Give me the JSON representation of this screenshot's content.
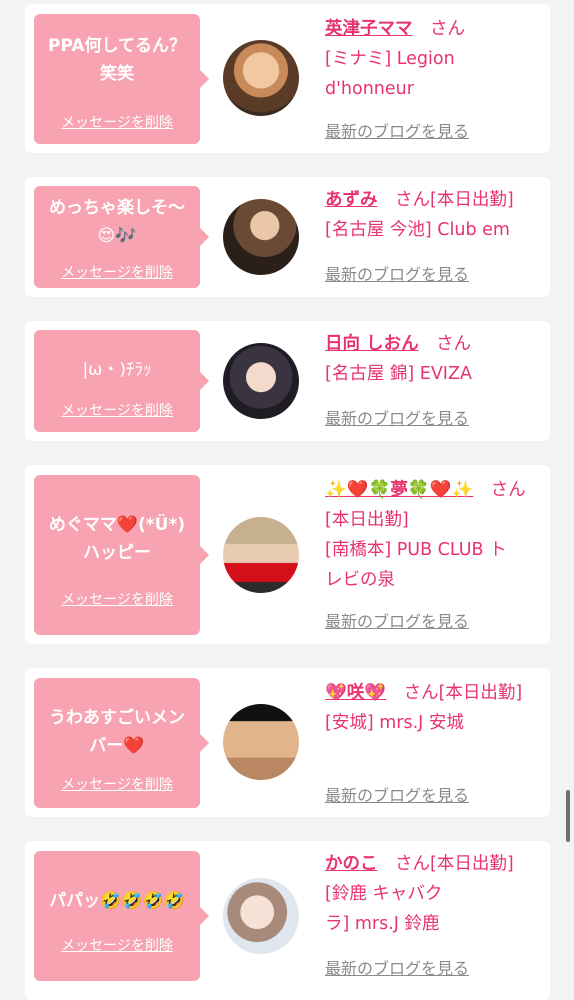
{
  "delete_label": "メッセージを削除",
  "blog_label": "最新のブログを見る",
  "san_label": "さん",
  "accent_color": "#e8336d",
  "bubble_color": "#f7a3b1",
  "cards": [
    {
      "message": "PPA何してるん？\n笑笑",
      "name": "英津子ママ",
      "name_suffix": "",
      "shop_lines": "[ミナミ] Legion\nd'honneur"
    },
    {
      "message": "めっちゃ楽しそ〜\n😍🎶",
      "name": "あずみ",
      "name_suffix": "[本日出勤]",
      "shop_lines": "[名古屋 今池] Club em"
    },
    {
      "message": "|ω・)ﾁﾗｯ",
      "name": "日向 しおん",
      "name_suffix": "",
      "shop_lines": "[名古屋 錦] EVIZA"
    },
    {
      "message": "めぐママ❤️(*Ü*)\nハッピー",
      "name": "✨❤️🍀夢🍀❤️✨",
      "name_suffix": "[本日出勤]",
      "shop_lines": "[南橋本] PUB CLUB ト\nレビの泉"
    },
    {
      "message": "うわあすごいメン\nバー❤️",
      "name": "💖咲💖",
      "name_suffix": "[本日出勤]",
      "shop_lines": "[安城] mrs.J 安城"
    },
    {
      "message": "パパッ🤣🤣🤣🤣",
      "name": "かのこ",
      "name_suffix": "[本日出勤]",
      "shop_lines": "[鈴鹿 キャバク\nラ] mrs.J 鈴鹿"
    }
  ]
}
